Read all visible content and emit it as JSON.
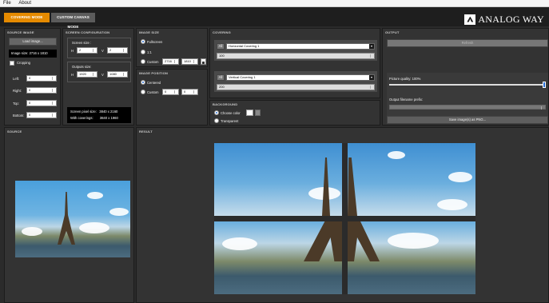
{
  "menu": {
    "file": "File",
    "about": "About"
  },
  "modes": {
    "covering": "COVERING MODE",
    "custom": "CUSTOM CANVAS MODE"
  },
  "brand": {
    "name": "ANALOG WAY"
  },
  "source_image": {
    "title": "SOURCE IMAGE",
    "load_button": "Load image...",
    "image_size": "Image size:   2716 x 1810",
    "cropping": "Cropping",
    "left_label": "Left:",
    "left": "0",
    "right_label": "Right:",
    "right": "0",
    "top_label": "Top:",
    "top": "0",
    "bottom_label": "Bottom:",
    "bottom": "0"
  },
  "screen_config": {
    "title": "SCREEN CONFIGURATION",
    "screen_size": "Screen size :",
    "h_label": "H",
    "h": "2",
    "v_label": "V",
    "v": "2",
    "outputs_size": "Outputs size:",
    "oh_label": "H",
    "oh": "1920",
    "ov_label": "V",
    "ov": "1080",
    "pixel_size": "Screen pixel size:   3840 x 2160",
    "with_coverings": "With coverings:       3840 x 1960"
  },
  "image_size": {
    "title": "IMAGE SIZE",
    "fullscreen": "Fullscreen",
    "one_to_one": "1:1",
    "custom": "Custom",
    "custom_w": "2716",
    "custom_h": "1810"
  },
  "image_position": {
    "title": "IMAGE POSITION",
    "centered": "Centered",
    "custom": "Custom",
    "x": "0",
    "y": "0"
  },
  "covering": {
    "title": "COVERING",
    "h_all": "All",
    "h_select": "Horizontal Covering 1",
    "h_value": "100",
    "v_all": "All",
    "v_select": "Vertical Covering 1",
    "v_value": "200"
  },
  "background": {
    "title": "BACKGROUND",
    "choose_color": "Choose color",
    "transparent": "Transparent"
  },
  "output": {
    "title": "OUTPUT",
    "refresh": "Refresh",
    "quality_label": "Picture quality: 100%",
    "quality": 1.0,
    "prefix_label": "Output filename prefix:",
    "prefix": "",
    "save": "Save image(s) as PNG..."
  },
  "source": {
    "title": "SOURCE"
  },
  "result": {
    "title": "RESULT"
  }
}
